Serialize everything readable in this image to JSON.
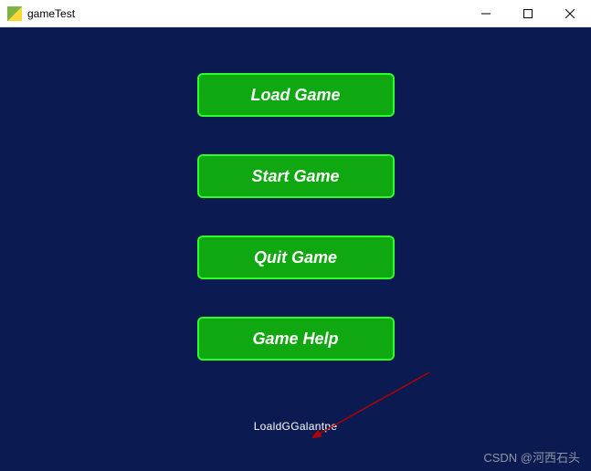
{
  "window": {
    "title": "gameTest"
  },
  "buttons": {
    "load": "Load Game",
    "start": "Start Game",
    "quit": "Quit Game",
    "help": "Game Help"
  },
  "overlap_label": "LoaldGGalantpe",
  "watermark": "CSDN @河西石头",
  "colors": {
    "background": "#0b1b52",
    "button_fill": "#10a810",
    "button_border": "#2aff2a",
    "button_text": "#ffffff",
    "arrow": "#b00000"
  }
}
